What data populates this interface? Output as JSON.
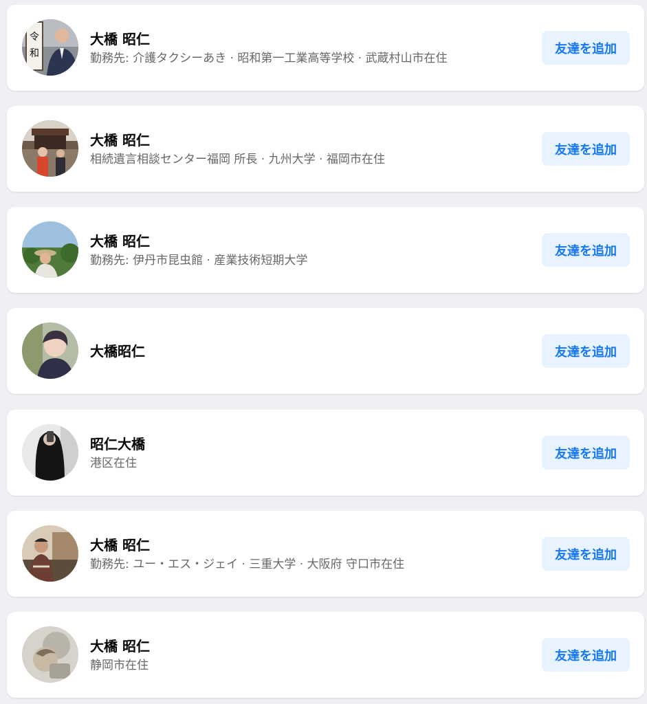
{
  "people": [
    {
      "name": "大橋 昭仁",
      "detail": "勤務先: 介護タクシーあき · 昭和第一工業高等学校 · 武蔵村山市在住",
      "button": "友達を追加",
      "avatar": "avatar-photo-man-holding-reiwa-sign"
    },
    {
      "name": "大橋 昭仁",
      "detail": "相続遺言相談センター福岡 所長 · 九州大学 · 福岡市在住",
      "button": "友達を追加",
      "avatar": "avatar-photo-people-at-shrine"
    },
    {
      "name": "大橋 昭仁",
      "detail": "勤務先: 伊丹市昆虫館 · 産業技術短期大学",
      "button": "友達を追加",
      "avatar": "avatar-photo-person-with-hat-outdoors"
    },
    {
      "name": "大橋昭仁",
      "detail": "",
      "button": "友達を追加",
      "avatar": "avatar-photo-young-man"
    },
    {
      "name": "昭仁大橋",
      "detail": "港区在住",
      "button": "友達を追加",
      "avatar": "avatar-photo-mirror-selfie"
    },
    {
      "name": "大橋 昭仁",
      "detail": "勤務先: ユー・エス・ジェイ · 三重大学 · 大阪府 守口市在住",
      "button": "友達を追加",
      "avatar": "avatar-photo-man-outdoors"
    },
    {
      "name": "大橋 昭仁",
      "detail": "静岡市在住",
      "button": "友達を追加",
      "avatar": "avatar-photo-blurred-portrait"
    }
  ],
  "colors": {
    "background": "#eef0f3",
    "card": "#ffffff",
    "name_text": "#050505",
    "detail_text": "#65676b",
    "button_bg": "#e7f3ff",
    "button_text": "#1877f2"
  }
}
